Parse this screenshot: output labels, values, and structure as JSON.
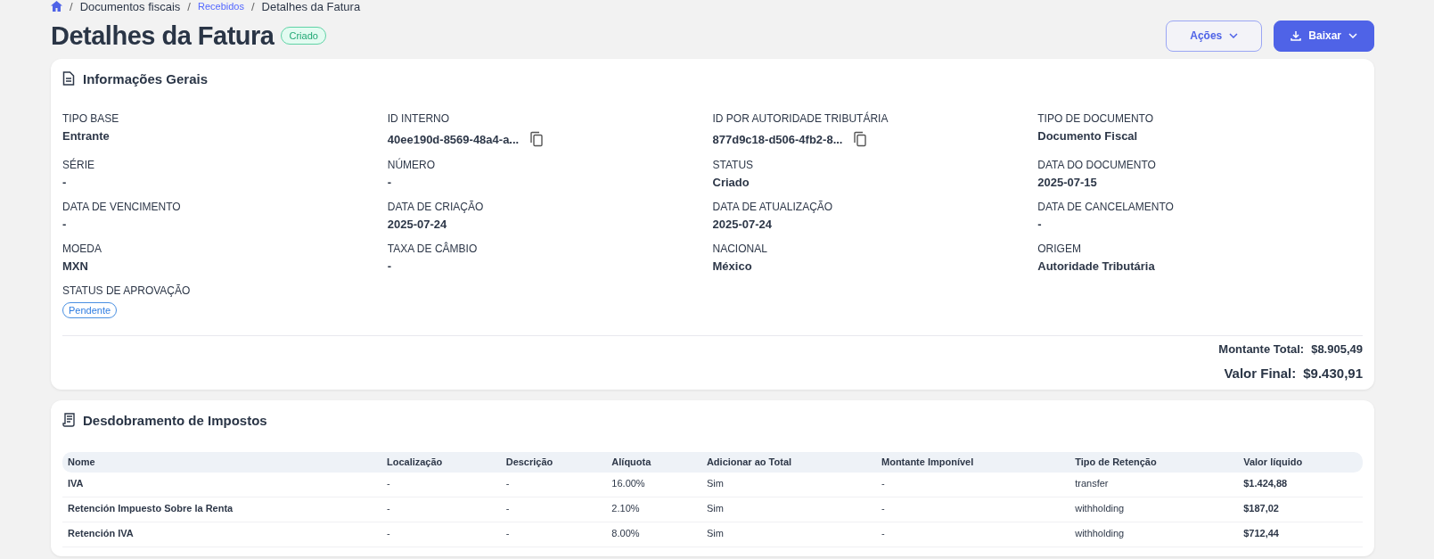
{
  "breadcrumb_separator": "/",
  "breadcrumb": [
    {
      "label": "Documentos fiscais",
      "link": false
    },
    {
      "label": "Recebidos",
      "link": true
    },
    {
      "label": "Detalhes da Fatura",
      "link": false
    }
  ],
  "title": "Detalhes da Fatura",
  "status_badge": "Criado",
  "actions": [
    {
      "label": "Ações",
      "kind": "outline"
    },
    {
      "label": "Baixar",
      "kind": "primary"
    }
  ],
  "general": {
    "heading": "Informações Gerais",
    "fields": [
      {
        "label": "TIPO BASE",
        "value": "Entrante",
        "kind": "text"
      },
      {
        "label": "ID INTERNO",
        "value": "40ee190d-8569-48a4-a...",
        "kind": "copy"
      },
      {
        "label": "ID POR AUTORIDADE TRIBUTÁRIA",
        "value": "877d9c18-d506-4fb2-8...",
        "kind": "copy"
      },
      {
        "label": "TIPO DE DOCUMENTO",
        "value": "Documento Fiscal",
        "kind": "text"
      },
      {
        "label": "SÉRIE",
        "value": "-",
        "kind": "text"
      },
      {
        "label": "NÚMERO",
        "value": "-",
        "kind": "text"
      },
      {
        "label": "STATUS",
        "value": "Criado",
        "kind": "text"
      },
      {
        "label": "DATA DO DOCUMENTO",
        "value": "2025-07-15",
        "kind": "text"
      },
      {
        "label": "DATA DE VENCIMENTO",
        "value": "-",
        "kind": "text"
      },
      {
        "label": "DATA DE CRIAÇÃO",
        "value": "2025-07-24",
        "kind": "text"
      },
      {
        "label": "DATA DE ATUALIZAÇÃO",
        "value": "2025-07-24",
        "kind": "text"
      },
      {
        "label": "DATA DE CANCELAMENTO",
        "value": "-",
        "kind": "text"
      },
      {
        "label": "MOEDA",
        "value": "MXN",
        "kind": "text"
      },
      {
        "label": "TAXA DE CÂMBIO",
        "value": "-",
        "kind": "text"
      },
      {
        "label": "NACIONAL",
        "value": "México",
        "kind": "text"
      },
      {
        "label": "ORIGEM",
        "value": "Autoridade Tributária",
        "kind": "text"
      },
      {
        "label": "STATUS DE APROVAÇÃO",
        "value": "Pendente",
        "kind": "badge"
      }
    ],
    "totals": [
      {
        "label": "Montante Total:",
        "value": "$8.905,49",
        "kind": "normal"
      },
      {
        "label": "Valor Final:",
        "value": "$9.430,91",
        "kind": "large"
      }
    ]
  },
  "taxes": {
    "heading": "Desdobramento de Impostos",
    "columns": [
      "Nome",
      "Localização",
      "Descrição",
      "Alíquota",
      "Adicionar ao Total",
      "Montante Imponível",
      "Tipo de Retenção",
      "Valor líquido"
    ],
    "rows": [
      [
        "IVA",
        "-",
        "-",
        "16.00%",
        "Sim",
        "-",
        "transfer",
        "$1.424,88"
      ],
      [
        "Retención Impuesto Sobre la Renta",
        "-",
        "-",
        "2.10%",
        "Sim",
        "-",
        "withholding",
        "$187,02"
      ],
      [
        "Retención IVA",
        "-",
        "-",
        "8.00%",
        "Sim",
        "-",
        "withholding",
        "$712,44"
      ]
    ]
  }
}
